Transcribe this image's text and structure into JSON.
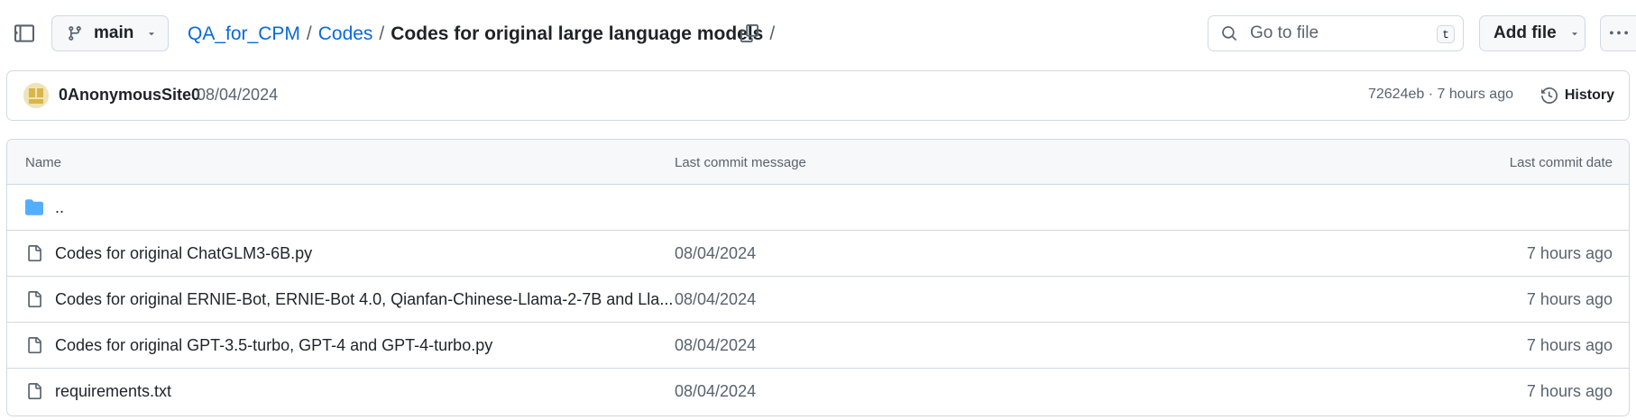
{
  "header": {
    "branch": "main",
    "breadcrumb": {
      "repo": "QA_for_CPM",
      "folder": "Codes",
      "current": "Codes for original large language models",
      "trailing_sep": "/"
    },
    "search": {
      "placeholder": "Go to file",
      "shortcut": "t"
    },
    "add_file_label": "Add file"
  },
  "commit": {
    "author": "0AnonymousSite0",
    "message": "08/04/2024",
    "meta": "72624eb · 7 hours ago",
    "history_label": "History"
  },
  "table": {
    "headers": {
      "name": "Name",
      "message": "Last commit message",
      "date": "Last commit date"
    },
    "parent_dir": "..",
    "rows": [
      {
        "name": "Codes for original ChatGLM3-6B.py",
        "message": "08/04/2024",
        "date": "7 hours ago"
      },
      {
        "name": "Codes for original ERNIE-Bot, ERNIE-Bot 4.0, Qianfan-Chinese-Llama-2-7B and Lla...",
        "message": "08/04/2024",
        "date": "7 hours ago"
      },
      {
        "name": "Codes for original GPT-3.5-turbo, GPT-4 and GPT-4-turbo.py",
        "message": "08/04/2024",
        "date": "7 hours ago"
      },
      {
        "name": "requirements.txt",
        "message": "08/04/2024",
        "date": "7 hours ago"
      }
    ]
  },
  "colors": {
    "link": "#0969da",
    "folder": "#54aeff",
    "muted": "#59636e",
    "border": "#d1d9e0"
  }
}
